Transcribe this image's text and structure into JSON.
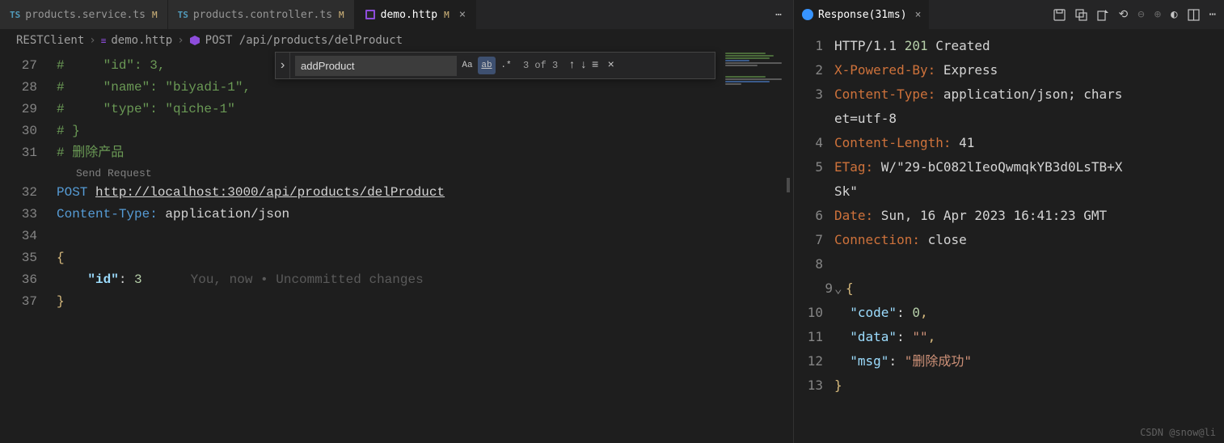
{
  "tabs": [
    {
      "icon": "TS",
      "label": "products.service.ts",
      "mod": "M"
    },
    {
      "icon": "TS",
      "label": "products.controller.ts",
      "mod": "M"
    },
    {
      "icon": "HTTP",
      "label": "demo.http",
      "mod": "M",
      "active": true
    }
  ],
  "breadcrumb": {
    "root": "RESTClient",
    "file": "demo.http",
    "symbol": "POST /api/products/delProduct"
  },
  "find": {
    "value": "addProduct",
    "count": "3 of 3"
  },
  "editor": {
    "lines": [
      {
        "n": 27,
        "type": "comment",
        "text": "#     \"id\": 3,"
      },
      {
        "n": 28,
        "type": "comment",
        "text": "#     \"name\": \"biyadi-1\","
      },
      {
        "n": 29,
        "type": "comment",
        "text": "#     \"type\": \"qiche-1\""
      },
      {
        "n": 30,
        "type": "comment",
        "text": "# }"
      },
      {
        "n": 31,
        "type": "comment",
        "text": "# 删除产品"
      }
    ],
    "codelens": "Send Request",
    "request": {
      "n": 32,
      "method": "POST",
      "url": "http://localhost:3000/api/products/delProduct"
    },
    "header": {
      "n": 33,
      "name": "Content-Type:",
      "value": " application/json"
    },
    "blank": {
      "n": 34
    },
    "body_open": {
      "n": 35,
      "text": "{"
    },
    "body_key": {
      "n": 36,
      "indent": "    ",
      "key": "\"id\"",
      "colon": ": ",
      "val": "3",
      "blame": "You, now • Uncommitted changes"
    },
    "body_close": {
      "n": 37,
      "text": "}"
    }
  },
  "response": {
    "title": "Response(31ms)",
    "lines": [
      {
        "n": 1,
        "proto": "HTTP/1.1 ",
        "code": "201",
        "status": " Created"
      },
      {
        "n": 2,
        "h": "X-Powered-By:",
        "v": " Express"
      },
      {
        "n": 3,
        "h": "Content-Type:",
        "v": " application/json; chars"
      },
      {
        "n": 0,
        "cont": "et=utf-8"
      },
      {
        "n": 4,
        "h": "Content-Length:",
        "v": " 41"
      },
      {
        "n": 5,
        "h": "ETag:",
        "v": " W/\"29-bC082lIeoQwmqkYB3d0LsTB+X"
      },
      {
        "n": 0,
        "cont": "Sk\""
      },
      {
        "n": 6,
        "h": "Date:",
        "v": " Sun, 16 Apr 2023 16:41:23 GMT"
      },
      {
        "n": 7,
        "h": "Connection:",
        "v": " close"
      },
      {
        "n": 8,
        "blank": true
      },
      {
        "n": 9,
        "fold": true,
        "p": "{"
      },
      {
        "n": 10,
        "k": "\"code\"",
        "colon": ": ",
        "num": "0",
        "comma": ","
      },
      {
        "n": 11,
        "k": "\"data\"",
        "colon": ": ",
        "str": "\"\"",
        "comma": ","
      },
      {
        "n": 12,
        "k": "\"msg\"",
        "colon": ": ",
        "str": "\"删除成功\""
      },
      {
        "n": 13,
        "p": "}"
      }
    ]
  },
  "watermark": "CSDN @snow@li"
}
